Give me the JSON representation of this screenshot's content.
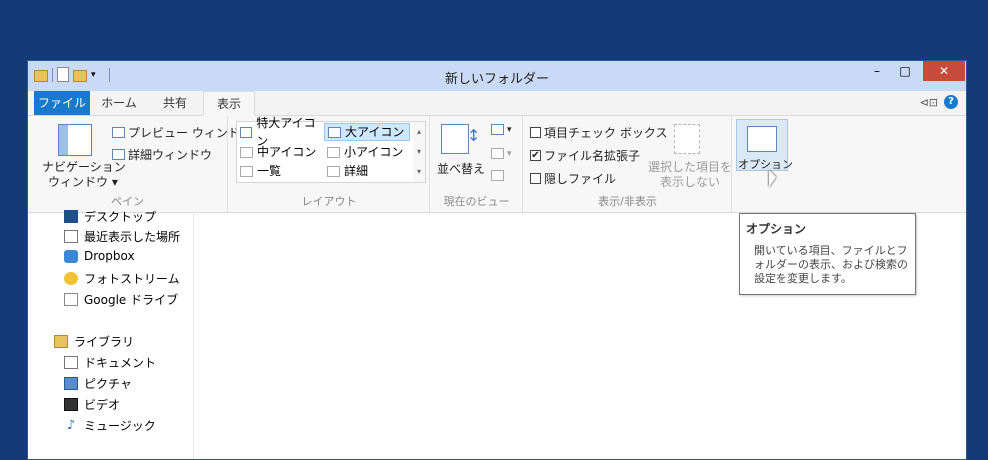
{
  "window": {
    "title": "新しいフォルダー"
  },
  "controls": {
    "minimize": "–",
    "maximize": "□",
    "close": "✕"
  },
  "tabs": [
    {
      "label": "ファイル"
    },
    {
      "label": "ホーム"
    },
    {
      "label": "共有"
    },
    {
      "label": "表示"
    }
  ],
  "help": {
    "label": "?"
  },
  "ribbon": {
    "pane": {
      "group_label": "ペイン",
      "nav_pane_line1": "ナビゲーション",
      "nav_pane_line2": "ウィンドウ ▾",
      "preview": "プレビュー ウィンドウ",
      "details": "詳細ウィンドウ"
    },
    "layout": {
      "group_label": "レイアウト",
      "items": [
        "特大アイコン",
        "大アイコン",
        "中アイコン",
        "小アイコン",
        "一覧",
        "詳細"
      ]
    },
    "current_view": {
      "group_label": "現在のビュー",
      "sort": "並べ替え"
    },
    "show_hide": {
      "group_label": "表示/非表示",
      "item_checkboxes": "項目チェック ボックス",
      "file_extensions": "ファイル名拡張子",
      "hidden_items": "隠しファイル",
      "hide_selected_line1": "選択した項目を",
      "hide_selected_line2": "表示しない",
      "check_mark": "✔"
    },
    "options": {
      "label": "オプション"
    }
  },
  "nav": {
    "items": [
      "デスクトップ",
      "最近表示した場所",
      "Dropbox",
      "フォトストリーム",
      "Google ドライブ"
    ],
    "library": "ライブラリ",
    "library_items": [
      "ドキュメント",
      "ピクチャ",
      "ビデオ",
      "ミュージック"
    ],
    "music_glyph": "♪"
  },
  "tooltip": {
    "title": "オプション",
    "body": "開いている項目、ファイルとフォルダーの表示、および検索の設定を変更します。"
  },
  "colors": {
    "desktop": "#123b78",
    "accent": "#1979ca",
    "close": "#c74b3c"
  }
}
